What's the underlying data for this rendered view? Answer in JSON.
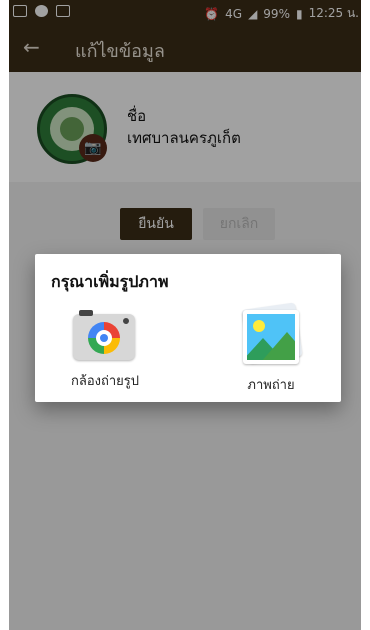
{
  "status_bar": {
    "left_icons": [
      "gmail-icon",
      "line-icon",
      "image-icon"
    ],
    "alarm": "⏰",
    "network": "4G",
    "battery": "99%",
    "time": "12:25 น."
  },
  "app_bar": {
    "back_icon": "←",
    "title": "แก้ไขข้อมูล"
  },
  "profile": {
    "name_label": "ชื่อ",
    "name_value": "เทศบาลนครภูเก็ต",
    "camera_badge_icon": "📷"
  },
  "actions": {
    "confirm_label": "ยืนยัน",
    "cancel_label": "ยกเลิก"
  },
  "dialog": {
    "title": "กรุณาเพิ่มรูปภาพ",
    "options": [
      {
        "label": "กล้องถ่ายรูป",
        "icon": "camera-app-icon"
      },
      {
        "label": "ภาพถ่าย",
        "icon": "gallery-app-icon"
      }
    ]
  },
  "colors": {
    "brand_dark": "#3c2d17",
    "scrim": "rgba(0,0,0,0.37)"
  }
}
